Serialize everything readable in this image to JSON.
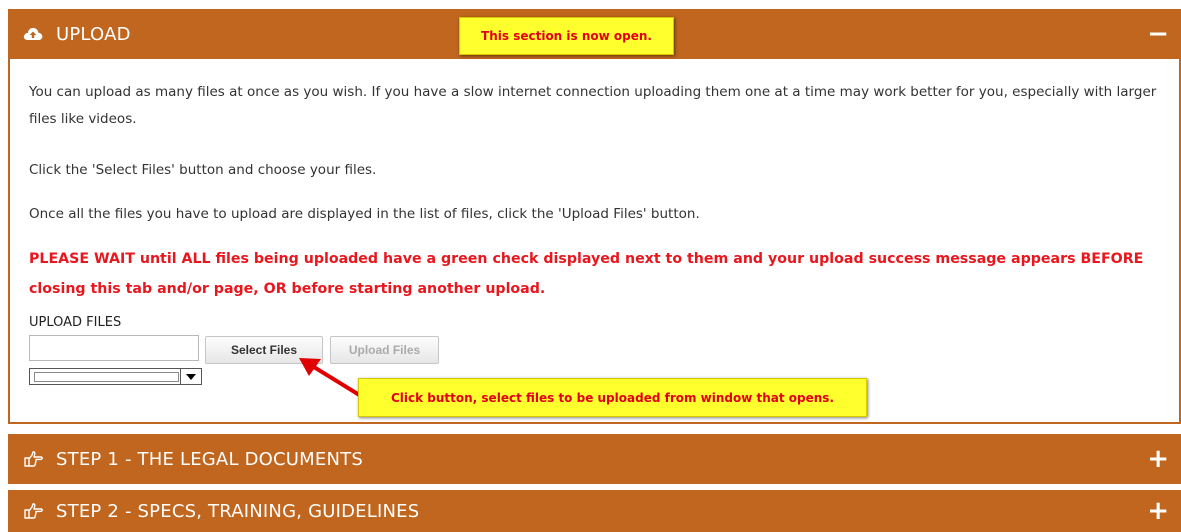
{
  "colors": {
    "section_header": "#c0661e",
    "callout_bg": "#ffff2e",
    "callout_text": "#e3001b",
    "warning_text": "#e8171e"
  },
  "upload_section": {
    "icon": "cloud-upload-icon",
    "title": "UPLOAD",
    "toggle": "−",
    "callout": "This section is now open.",
    "paragraphs": [
      "You can upload as many files at once as you wish. If you have a slow internet connection uploading them one at a time may work better for you, especially with larger files like videos.",
      "Click the 'Select Files' button and choose your files.",
      "Once all the files you have to upload are displayed in the list of files, click the 'Upload Files' button."
    ],
    "warning": "PLEASE WAIT until ALL files being uploaded have a green check displayed next to them and your upload success message appears BEFORE closing this tab and/or page, OR before starting another upload.",
    "upload_files_label": "UPLOAD FILES",
    "file_input_value": "",
    "select_files_button": "Select Files",
    "upload_files_button": "Upload Files",
    "select_value": "",
    "button_callout": "Click button, select files to be uploaded from window that opens."
  },
  "step1_section": {
    "icon": "hand-pointer-icon",
    "title": "STEP 1 - THE LEGAL DOCUMENTS",
    "toggle": "+"
  },
  "step2_section": {
    "icon": "hand-pointer-icon",
    "title": "STEP 2 - SPECS, TRAINING, GUIDELINES",
    "toggle": "+"
  }
}
